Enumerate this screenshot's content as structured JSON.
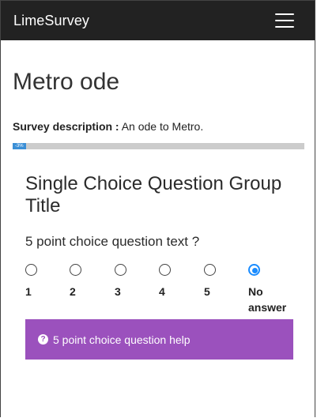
{
  "navbar": {
    "brand": "LimeSurvey",
    "menu_icon": "hamburger-menu-icon"
  },
  "survey": {
    "title": "Metro ode",
    "description_label": "Survey description :",
    "description_text": "An ode to Metro.",
    "progress_label": "-3%",
    "progress_percent": 4.5
  },
  "group": {
    "title": "Single Choice Question Group Title"
  },
  "question": {
    "text": "5 point choice question text ?",
    "choices": [
      {
        "label": "1",
        "selected": false
      },
      {
        "label": "2",
        "selected": false
      },
      {
        "label": "3",
        "selected": false
      },
      {
        "label": "4",
        "selected": false
      },
      {
        "label": "5",
        "selected": false
      },
      {
        "label_line1": "No",
        "label_line2": "answer",
        "selected": true
      }
    ],
    "help_text": "5 point choice question help",
    "help_icon": "question-circle-icon"
  },
  "colors": {
    "navbar_bg": "#222222",
    "help_bg": "#9b51bd",
    "progress_fill": "#3b8fd6",
    "radio_selected": "#1a8cff"
  }
}
